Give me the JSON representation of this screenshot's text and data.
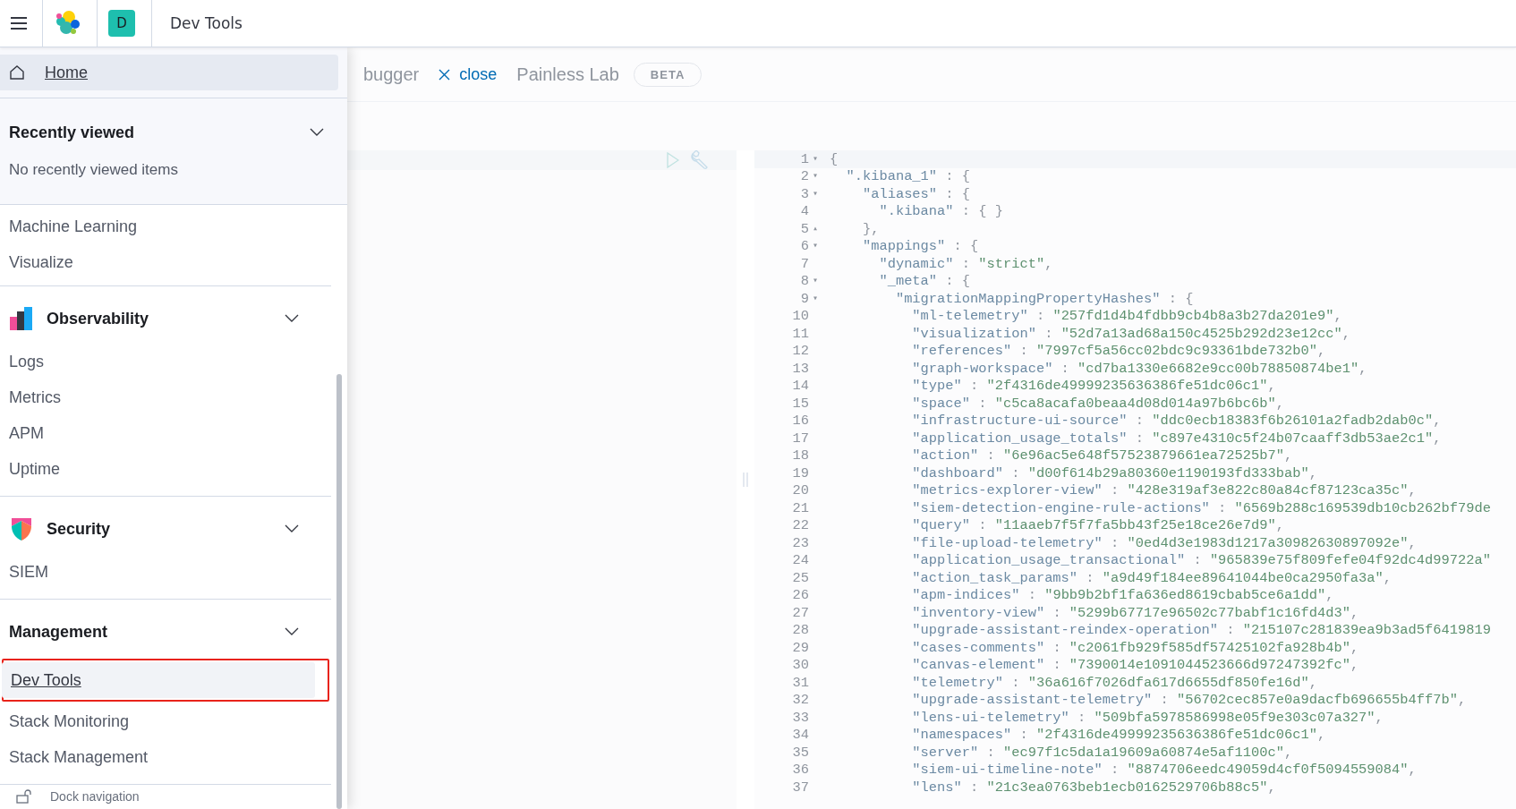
{
  "header": {
    "avatar_letter": "D",
    "breadcrumb": "Dev Tools"
  },
  "sidebar": {
    "home": {
      "label": "Home",
      "selected": true
    },
    "recently_viewed": {
      "title": "Recently viewed",
      "expanded": true,
      "empty_text": "No recently viewed items"
    },
    "items": [
      {
        "label": "Machine Learning",
        "selected": false
      },
      {
        "label": "Visualize",
        "selected": false
      }
    ],
    "groups": [
      {
        "title": "Observability",
        "kind": "observability",
        "expanded": true,
        "items": [
          {
            "label": "Logs",
            "selected": false,
            "annotated": false
          },
          {
            "label": "Metrics",
            "selected": false,
            "annotated": false
          },
          {
            "label": "APM",
            "selected": false,
            "annotated": false
          },
          {
            "label": "Uptime",
            "selected": false,
            "annotated": false
          }
        ]
      },
      {
        "title": "Security",
        "kind": "security",
        "expanded": true,
        "items": [
          {
            "label": "SIEM",
            "selected": false,
            "annotated": false
          }
        ]
      },
      {
        "title": "Management",
        "kind": "management",
        "expanded": true,
        "items": [
          {
            "label": "Dev Tools",
            "selected": true,
            "annotated": true
          },
          {
            "label": "Stack Monitoring",
            "selected": false,
            "annotated": false
          },
          {
            "label": "Stack Management",
            "selected": false,
            "annotated": false
          }
        ]
      }
    ],
    "dock_label": "Dock navigation"
  },
  "tabs": [
    {
      "label": "bugger"
    },
    {
      "label": "Painless Lab",
      "badge": "BETA"
    }
  ],
  "close_button": "close",
  "response_lines": [
    {
      "number": "1",
      "fold": "▾",
      "text": "{"
    },
    {
      "number": "2",
      "fold": "▾",
      "text": "  \".kibana_1\" : {"
    },
    {
      "number": "3",
      "fold": "▾",
      "text": "    \"aliases\" : {"
    },
    {
      "number": "4",
      "text": "      \".kibana\" : { }"
    },
    {
      "number": "5",
      "fold": "▴",
      "text": "    },"
    },
    {
      "number": "6",
      "fold": "▾",
      "text": "    \"mappings\" : {"
    },
    {
      "number": "7",
      "text": "      \"dynamic\" : \"strict\","
    },
    {
      "number": "8",
      "fold": "▾",
      "text": "      \"_meta\" : {"
    },
    {
      "number": "9",
      "fold": "▾",
      "text": "        \"migrationMappingPropertyHashes\" : {"
    },
    {
      "number": "10",
      "text": "          \"ml-telemetry\" : \"257fd1d4b4fdbb9cb4b8a3b27da201e9\","
    },
    {
      "number": "11",
      "text": "          \"visualization\" : \"52d7a13ad68a150c4525b292d23e12cc\","
    },
    {
      "number": "12",
      "text": "          \"references\" : \"7997cf5a56cc02bdc9c93361bde732b0\","
    },
    {
      "number": "13",
      "text": "          \"graph-workspace\" : \"cd7ba1330e6682e9cc00b78850874be1\","
    },
    {
      "number": "14",
      "text": "          \"type\" : \"2f4316de49999235636386fe51dc06c1\","
    },
    {
      "number": "15",
      "text": "          \"space\" : \"c5ca8acafa0beaa4d08d014a97b6bc6b\","
    },
    {
      "number": "16",
      "text": "          \"infrastructure-ui-source\" : \"ddc0ecb18383f6b26101a2fadb2dab0c\","
    },
    {
      "number": "17",
      "text": "          \"application_usage_totals\" : \"c897e4310c5f24b07caaff3db53ae2c1\","
    },
    {
      "number": "18",
      "text": "          \"action\" : \"6e96ac5e648f57523879661ea72525b7\","
    },
    {
      "number": "19",
      "text": "          \"dashboard\" : \"d00f614b29a80360e1190193fd333bab\","
    },
    {
      "number": "20",
      "text": "          \"metrics-explorer-view\" : \"428e319af3e822c80a84cf87123ca35c\","
    },
    {
      "number": "21",
      "text": "          \"siem-detection-engine-rule-actions\" : \"6569b288c169539db10cb262bf79de"
    },
    {
      "number": "22",
      "text": "          \"query\" : \"11aaeb7f5f7fa5bb43f25e18ce26e7d9\","
    },
    {
      "number": "23",
      "text": "          \"file-upload-telemetry\" : \"0ed4d3e1983d1217a30982630897092e\","
    },
    {
      "number": "24",
      "text": "          \"application_usage_transactional\" : \"965839e75f809fefe04f92dc4d99722a\""
    },
    {
      "number": "25",
      "text": "          \"action_task_params\" : \"a9d49f184ee89641044be0ca2950fa3a\","
    },
    {
      "number": "26",
      "text": "          \"apm-indices\" : \"9bb9b2bf1fa636ed8619cbab5ce6a1dd\","
    },
    {
      "number": "27",
      "text": "          \"inventory-view\" : \"5299b67717e96502c77babf1c16fd4d3\","
    },
    {
      "number": "28",
      "text": "          \"upgrade-assistant-reindex-operation\" : \"215107c281839ea9b3ad5f6419819"
    },
    {
      "number": "29",
      "text": "          \"cases-comments\" : \"c2061fb929f585df57425102fa928b4b\","
    },
    {
      "number": "30",
      "text": "          \"canvas-element\" : \"7390014e1091044523666d97247392fc\","
    },
    {
      "number": "31",
      "text": "          \"telemetry\" : \"36a616f7026dfa617d6655df850fe16d\","
    },
    {
      "number": "32",
      "text": "          \"upgrade-assistant-telemetry\" : \"56702cec857e0a9dacfb696655b4ff7b\","
    },
    {
      "number": "33",
      "text": "          \"lens-ui-telemetry\" : \"509bfa5978586998e05f9e303c07a327\","
    },
    {
      "number": "34",
      "text": "          \"namespaces\" : \"2f4316de49999235636386fe51dc06c1\","
    },
    {
      "number": "35",
      "text": "          \"server\" : \"ec97f1c5da1a19609a60874e5af1100c\","
    },
    {
      "number": "36",
      "text": "          \"siem-ui-timeline-note\" : \"8874706eedc49059d4cf0f5094559084\","
    },
    {
      "number": "37",
      "text": "          \"lens\" : \"21c3ea0763beb1ecb0162529706b88c5\","
    }
  ]
}
